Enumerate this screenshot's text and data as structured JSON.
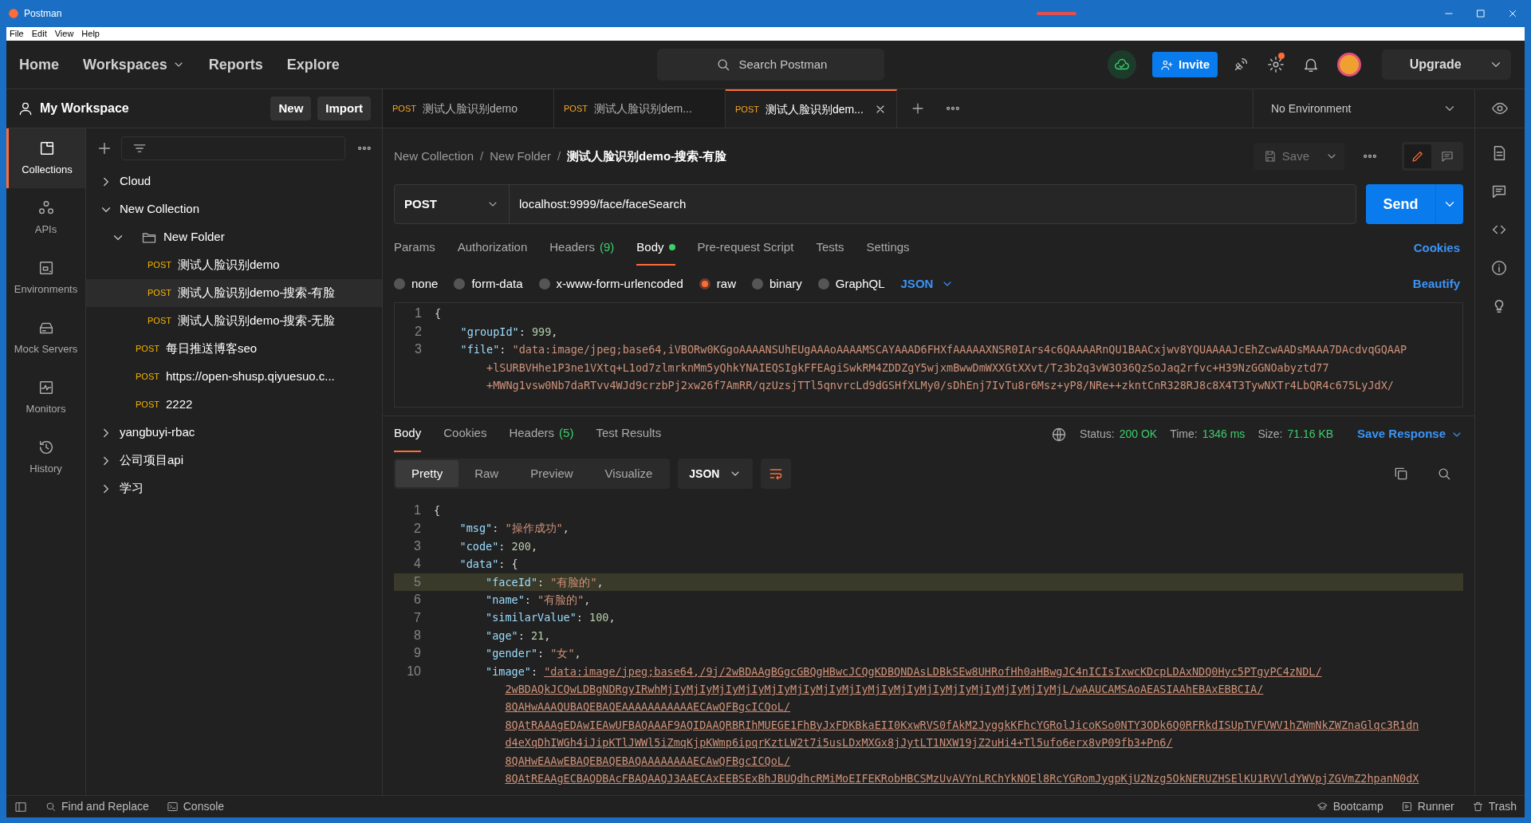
{
  "window": {
    "title": "Postman"
  },
  "menu": [
    "File",
    "Edit",
    "View",
    "Help"
  ],
  "nav": [
    {
      "label": "Home",
      "dropdown": false
    },
    {
      "label": "Workspaces",
      "dropdown": true
    },
    {
      "label": "Reports",
      "dropdown": false
    },
    {
      "label": "Explore",
      "dropdown": false
    }
  ],
  "search": {
    "placeholder": "Search Postman"
  },
  "invite": "Invite",
  "upgrade": "Upgrade",
  "workspace": {
    "name": "My Workspace",
    "buttons": [
      "New",
      "Import"
    ]
  },
  "tabs": [
    {
      "method": "POST",
      "label": "测试人脸识别demo",
      "selected": false
    },
    {
      "method": "POST",
      "label": "测试人脸识别dem...",
      "selected": false
    },
    {
      "method": "POST",
      "label": "测试人脸识别dem...",
      "selected": true
    }
  ],
  "environment": "No Environment",
  "rail": [
    {
      "kind": "collections",
      "label": "Collections",
      "selected": true
    },
    {
      "kind": "apis",
      "label": "APIs",
      "selected": false
    },
    {
      "kind": "environments",
      "label": "Environments",
      "selected": false
    },
    {
      "kind": "mock",
      "label": "Mock Servers",
      "selected": false
    },
    {
      "kind": "monitors",
      "label": "Monitors",
      "selected": false
    },
    {
      "kind": "history",
      "label": "History",
      "selected": false
    }
  ],
  "tree": [
    {
      "kind": "collection",
      "label": "Cloud",
      "expanded": false
    },
    {
      "kind": "collection",
      "label": "New Collection",
      "expanded": true,
      "children": [
        {
          "kind": "folder",
          "label": "New Folder",
          "expanded": true,
          "children": [
            {
              "kind": "request",
              "method": "POST",
              "label": "测试人脸识别demo",
              "selected": false
            },
            {
              "kind": "request",
              "method": "POST",
              "label": "测试人脸识别demo-搜索-有脸",
              "selected": true
            },
            {
              "kind": "request",
              "method": "POST",
              "label": "测试人脸识别demo-搜索-无脸",
              "selected": false
            }
          ]
        },
        {
          "kind": "request",
          "method": "POST",
          "label": "每日推送博客seo",
          "selected": false
        },
        {
          "kind": "request",
          "method": "POST",
          "label": "https://open-shusp.qiyuesuo.c...",
          "selected": false
        },
        {
          "kind": "request",
          "method": "POST",
          "label": "2222",
          "selected": false
        }
      ]
    },
    {
      "kind": "collection",
      "label": "yangbuyi-rbac",
      "expanded": false
    },
    {
      "kind": "collection",
      "label": "公司项目api",
      "expanded": false
    },
    {
      "kind": "collection",
      "label": "学习",
      "expanded": false
    }
  ],
  "breadcrumb": [
    {
      "kind": "link",
      "label": "New Collection"
    },
    {
      "kind": "separator",
      "label": "/"
    },
    {
      "kind": "link",
      "label": "New Folder"
    },
    {
      "kind": "separator",
      "label": "/"
    },
    {
      "kind": "current",
      "label": "测试人脸识别demo-搜索-有脸"
    }
  ],
  "save": "Save",
  "request": {
    "method": "POST",
    "url": "localhost:9999/face/faceSearch",
    "send": "Send"
  },
  "request_tabs": [
    {
      "label": "Params",
      "selected": false
    },
    {
      "label": "Authorization",
      "selected": false
    },
    {
      "label": "Headers",
      "count": "(9)",
      "selected": false
    },
    {
      "label": "Body",
      "dot": true,
      "selected": true
    },
    {
      "label": "Pre-request Script",
      "selected": false
    },
    {
      "label": "Tests",
      "selected": false
    },
    {
      "label": "Settings",
      "selected": false
    }
  ],
  "cookies": "Cookies",
  "body_types": [
    {
      "label": "none",
      "selected": false
    },
    {
      "label": "form-data",
      "selected": false
    },
    {
      "label": "x-www-form-urlencoded",
      "selected": false
    },
    {
      "label": "raw",
      "selected": true
    },
    {
      "label": "binary",
      "selected": false
    },
    {
      "label": "GraphQL",
      "selected": false
    }
  ],
  "body_format": "JSON",
  "beautify": "Beautify",
  "request_body": [
    {
      "number": "1",
      "tokens": [
        {
          "kind": "punct",
          "text": "{"
        }
      ]
    },
    {
      "number": "2",
      "tokens": [
        {
          "kind": "key",
          "text": "    \"groupId\""
        },
        {
          "kind": "punct",
          "text": ": "
        },
        {
          "kind": "number",
          "text": "999"
        },
        {
          "kind": "punct",
          "text": ","
        }
      ]
    },
    {
      "number": "3",
      "tokens": [
        {
          "kind": "key",
          "text": "    \"file\""
        },
        {
          "kind": "punct",
          "text": ": "
        },
        {
          "kind": "string",
          "text": "\"data:image/jpeg;base64,iVBORw0KGgoAAAANSUhEUgAAAoAAAAMSCAYAAAD6FHXfAAAAAXNSR0IArs4c6QAAAARnQU1BAACxjwv8YQUAAAAJcEhZcwAADsMAAA7DAcdvqGQAAP"
        }
      ]
    },
    {
      "tokens": [
        {
          "kind": "string",
          "text": "        +lSURBVHhe1P3ne1VXtq+L1od7zlmrknMm5yQhkYNAIEQSIgkFFEAgiSwkRM4ZDDZgY5wjxmBwwDmWXXGtXXvt/Tz3b2q3vW3O36QzSoJaq2rfvc+H39NzGGNOabyztd77"
        }
      ]
    },
    {
      "tokens": [
        {
          "kind": "string",
          "text": "        +MWNg1vsw0Nb7daRTvv4WJd9crzbPj2xw26f7AmRR/qzUzsjTTl5qnvrcLd9dGSHfXLMy0/sDhEnj7IvTu8r6Msz+yP8/NRe++zkntCnR328RJ8c8X4T3TywNXTr4LbQR4c675LyJdX/"
        }
      ]
    }
  ],
  "response_tabs": [
    {
      "label": "Body",
      "selected": true
    },
    {
      "label": "Cookies",
      "selected": false
    },
    {
      "label": "Headers",
      "count": "(5)",
      "selected": false
    },
    {
      "label": "Test Results",
      "selected": false
    }
  ],
  "status": {
    "status_label": "Status:",
    "status": "200 OK",
    "time_label": "Time:",
    "time": "1346 ms",
    "size_label": "Size:",
    "size": "71.16 KB"
  },
  "save_response": "Save Response",
  "view_tabs": [
    {
      "label": "Pretty",
      "selected": true
    },
    {
      "label": "Raw",
      "selected": false
    },
    {
      "label": "Preview",
      "selected": false
    },
    {
      "label": "Visualize",
      "selected": false
    }
  ],
  "response_format": "JSON",
  "response_body": [
    {
      "number": "1",
      "selected": false,
      "tokens": [
        {
          "kind": "punct",
          "text": "{"
        }
      ]
    },
    {
      "number": "2",
      "selected": false,
      "tokens": [
        {
          "kind": "key",
          "text": "    \"msg\""
        },
        {
          "kind": "punct",
          "text": ": "
        },
        {
          "kind": "string",
          "text": "\"操作成功\""
        },
        {
          "kind": "punct",
          "text": ","
        }
      ]
    },
    {
      "number": "3",
      "selected": false,
      "tokens": [
        {
          "kind": "key",
          "text": "    \"code\""
        },
        {
          "kind": "punct",
          "text": ": "
        },
        {
          "kind": "number",
          "text": "200"
        },
        {
          "kind": "punct",
          "text": ","
        }
      ]
    },
    {
      "number": "4",
      "selected": false,
      "tokens": [
        {
          "kind": "key",
          "text": "    \"data\""
        },
        {
          "kind": "punct",
          "text": ": {"
        }
      ]
    },
    {
      "number": "5",
      "selected": true,
      "tokens": [
        {
          "kind": "key",
          "text": "        \"faceId\""
        },
        {
          "kind": "punct",
          "text": ": "
        },
        {
          "kind": "string",
          "text": "\"有脸的\""
        },
        {
          "kind": "punct",
          "text": ","
        }
      ]
    },
    {
      "number": "6",
      "selected": false,
      "tokens": [
        {
          "kind": "key",
          "text": "        \"name\""
        },
        {
          "kind": "punct",
          "text": ": "
        },
        {
          "kind": "string",
          "text": "\"有脸的\""
        },
        {
          "kind": "punct",
          "text": ","
        }
      ]
    },
    {
      "number": "7",
      "selected": false,
      "tokens": [
        {
          "kind": "key",
          "text": "        \"similarValue\""
        },
        {
          "kind": "punct",
          "text": ": "
        },
        {
          "kind": "number",
          "text": "100"
        },
        {
          "kind": "punct",
          "text": ","
        }
      ]
    },
    {
      "number": "8",
      "selected": false,
      "tokens": [
        {
          "kind": "key",
          "text": "        \"age\""
        },
        {
          "kind": "punct",
          "text": ": "
        },
        {
          "kind": "number",
          "text": "21"
        },
        {
          "kind": "punct",
          "text": ","
        }
      ]
    },
    {
      "number": "9",
      "selected": false,
      "tokens": [
        {
          "kind": "key",
          "text": "        \"gender\""
        },
        {
          "kind": "punct",
          "text": ": "
        },
        {
          "kind": "string",
          "text": "\"女\""
        },
        {
          "kind": "punct",
          "text": ","
        }
      ]
    },
    {
      "number": "10",
      "selected": false,
      "tokens": [
        {
          "kind": "key",
          "text": "        \"image\""
        },
        {
          "kind": "punct",
          "text": ": "
        },
        {
          "kind": "link",
          "text": "\"data:image/jpeg;base64,/9j/2wBDAAgBGgcGBQgHBwcJCQgKDBQNDAsLDBkSEw8UHRofHh0aHBwgJC4nICIsIxwcKDcpLDAxNDQ0Hyc5PTgyPC4zNDL/"
        }
      ]
    },
    {
      "selected": false,
      "tokens": [
        {
          "kind": "link",
          "text": "           2wBDAQkJCQwLDBgNDRgyIRwhMjIyMjIyMjIyMjIyMjIyMjIyMjIyMjIyMjIyMjIyMjIyMjIyMjIyMjIyMjIyMjL/wAAUCAMSAoAEASIAAhEBAxEBBCIA/"
        }
      ]
    },
    {
      "selected": false,
      "tokens": [
        {
          "kind": "link",
          "text": "           8QAHwAAAQUBAQEBAQEAAAAAAAAAAAECAwQFBgcICQoL/"
        }
      ]
    },
    {
      "selected": false,
      "tokens": [
        {
          "kind": "link",
          "text": "           8QAtRAAAgEDAwIEAwUFBAQAAAF9AQIDAAQRBRIhMUEGE1FhByJxFDKBkaEII0KxwRVS0fAkM2JyggkKFhcYGRolJicoKSo0NTY3ODk6Q0RFRkdISUpTVFVWV1hZWmNkZWZnaGlqc3R1dn"
        }
      ]
    },
    {
      "selected": false,
      "tokens": [
        {
          "kind": "link",
          "text": "           d4eXqDhIWGh4iJipKTlJWWl5iZmqKjpKWmp6ipqrKztLW2t7i5usLDxMXGx8jJytLT1NXW19jZ2uHi4+Tl5ufo6erx8vP09fb3+Pn6/"
        }
      ]
    },
    {
      "selected": false,
      "tokens": [
        {
          "kind": "link",
          "text": "           8QAHwEAAwEBAQEBAQEBAQAAAAAAAAECAwQFBgcICQoL/"
        }
      ]
    },
    {
      "selected": false,
      "tokens": [
        {
          "kind": "link",
          "text": "           8QAtREAAgECBAQDBAcFBAQAAQJ3AAECAxEEBSExBhJBUQdhcRMiMoEIFEKRobHBCSMzUvAVYnLRChYkNOEl8RcYGRomJygpKjU2Nzg5OkNERUZHSElKU1RVVldYWVpjZGVmZ2hpanN0dX"
        }
      ]
    }
  ],
  "status_bar": {
    "left": [
      {
        "kind": "sidebar"
      },
      {
        "kind": "find",
        "label": "Find and Replace"
      },
      {
        "kind": "console",
        "label": "Console"
      }
    ],
    "right": [
      {
        "kind": "bootcamp",
        "label": "Bootcamp"
      },
      {
        "kind": "runner",
        "label": "Runner"
      },
      {
        "kind": "trash",
        "label": "Trash"
      }
    ]
  }
}
